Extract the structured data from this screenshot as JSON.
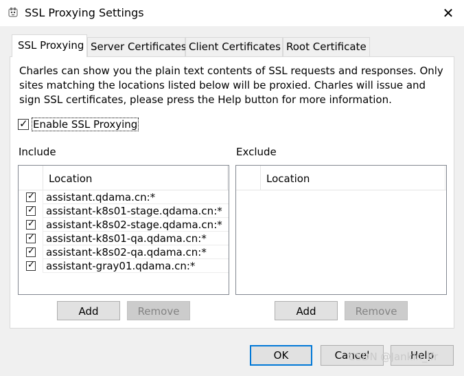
{
  "window": {
    "title": "SSL Proxying Settings",
    "close_glyph": "✕"
  },
  "tabs": [
    {
      "label": "SSL Proxying",
      "active": true
    },
    {
      "label": "Server Certificates",
      "active": false
    },
    {
      "label": "Client Certificates",
      "active": false
    },
    {
      "label": "Root Certificate",
      "active": false
    }
  ],
  "ssl_tab": {
    "description": "Charles can show you the plain text contents of SSL requests and responses. Only sites matching the locations listed below will be proxied. Charles will issue and sign SSL certificates, please press the Help button for more information.",
    "enable": {
      "label": "Enable SSL Proxying",
      "checked": true
    },
    "include": {
      "label": "Include",
      "column_header": "Location",
      "rows": [
        {
          "location": "assistant.qdama.cn:*",
          "checked": true
        },
        {
          "location": "assistant-k8s01-stage.qdama.cn:*",
          "checked": true
        },
        {
          "location": "assistant-k8s02-stage.qdama.cn:*",
          "checked": true
        },
        {
          "location": "assistant-k8s01-qa.qdama.cn:*",
          "checked": true
        },
        {
          "location": "assistant-k8s02-qa.qdama.cn:*",
          "checked": true
        },
        {
          "location": "assistant-gray01.qdama.cn:*",
          "checked": true
        }
      ],
      "add_label": "Add",
      "remove_label": "Remove"
    },
    "exclude": {
      "label": "Exclude",
      "column_header": "Location",
      "rows": [],
      "add_label": "Add",
      "remove_label": "Remove"
    }
  },
  "footer": {
    "ok_label": "OK",
    "cancel_label": "Cancel",
    "help_label": "Help"
  },
  "watermark": "CSDN @Jankin_lfr",
  "check_glyph": "✓",
  "colors": {
    "focus_border": "#0078d7",
    "disabled_text": "#838383"
  }
}
